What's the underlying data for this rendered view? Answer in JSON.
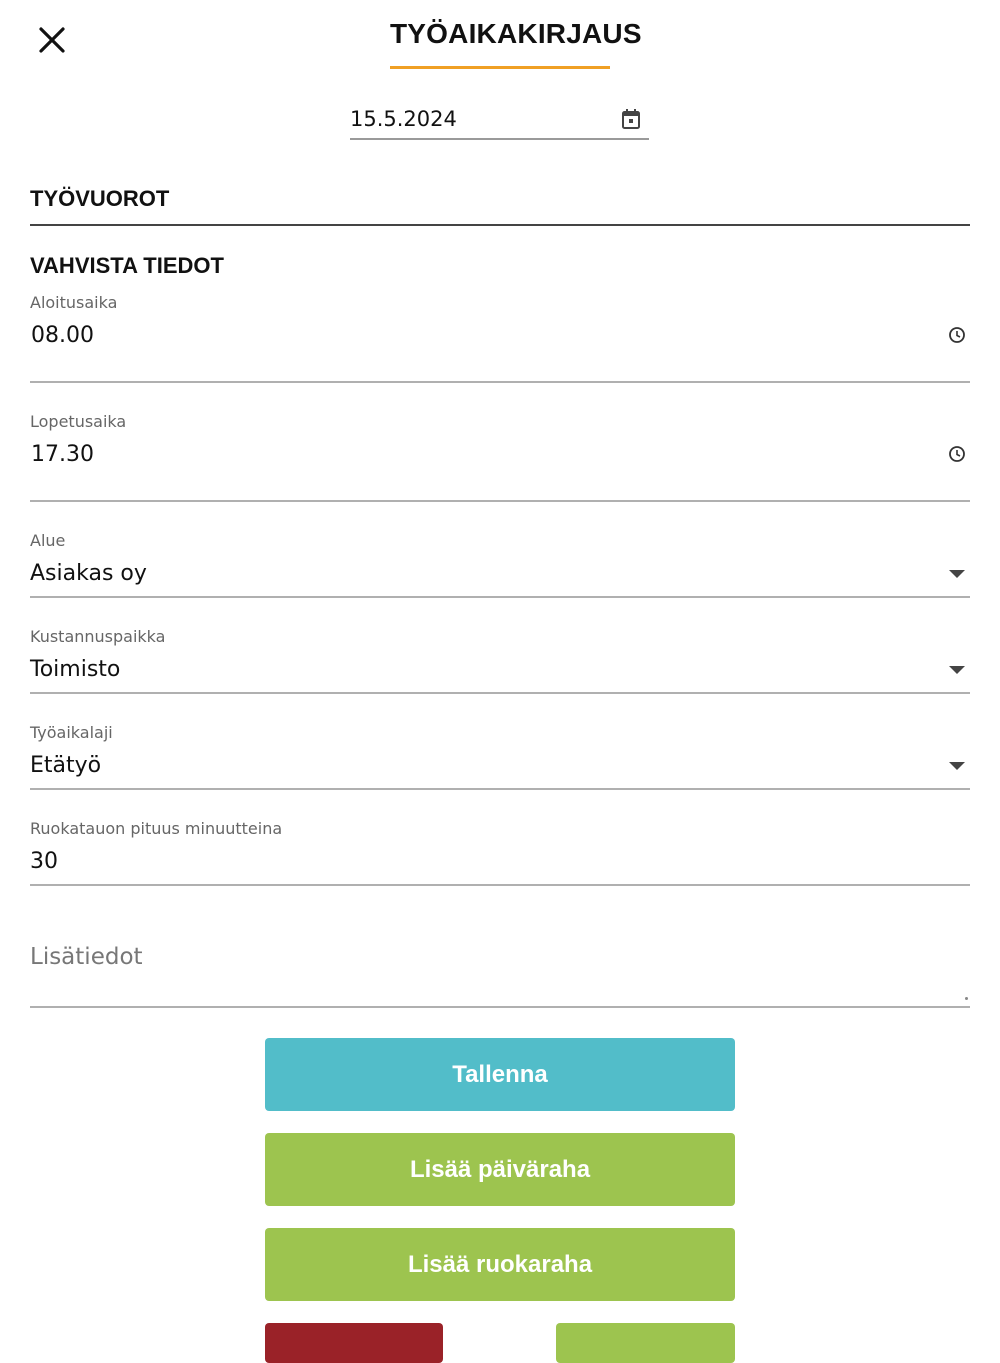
{
  "header": {
    "title": "TYÖAIKAKIRJAUS",
    "close_icon": "close-icon",
    "accent_color": "#f0a024"
  },
  "date": {
    "value": "15.5.2024",
    "icon": "calendar-icon"
  },
  "sections": {
    "shifts": "TYÖVUOROT",
    "confirm": "VAHVISTA TIEDOT"
  },
  "fields": {
    "start_time": {
      "label": "Aloitusaika",
      "value": "08.00",
      "icon": "clock-icon"
    },
    "end_time": {
      "label": "Lopetusaika",
      "value": "17.30",
      "icon": "clock-icon"
    },
    "area": {
      "label": "Alue",
      "value": "Asiakas oy",
      "icon": "dropdown-arrow-icon"
    },
    "cost_center": {
      "label": "Kustannuspaikka",
      "value": "Toimisto",
      "icon": "dropdown-arrow-icon"
    },
    "work_type": {
      "label": "Työaikalaji",
      "value": "Etätyö",
      "icon": "dropdown-arrow-icon"
    },
    "lunch_break": {
      "label": "Ruokatauon pituus minuutteina",
      "value": "30"
    },
    "notes": {
      "placeholder": "Lisätiedot",
      "value": ""
    }
  },
  "buttons": {
    "save": {
      "label": "Tallenna",
      "color": "#52bdc9"
    },
    "add_daily_allowance": {
      "label": "Lisää päiväraha",
      "color": "#9dc44f"
    },
    "add_meal_allowance": {
      "label": "Lisää ruokaraha",
      "color": "#9dc44f"
    },
    "partial_left_color": "#9a2228",
    "partial_right_color": "#9dc44f"
  }
}
